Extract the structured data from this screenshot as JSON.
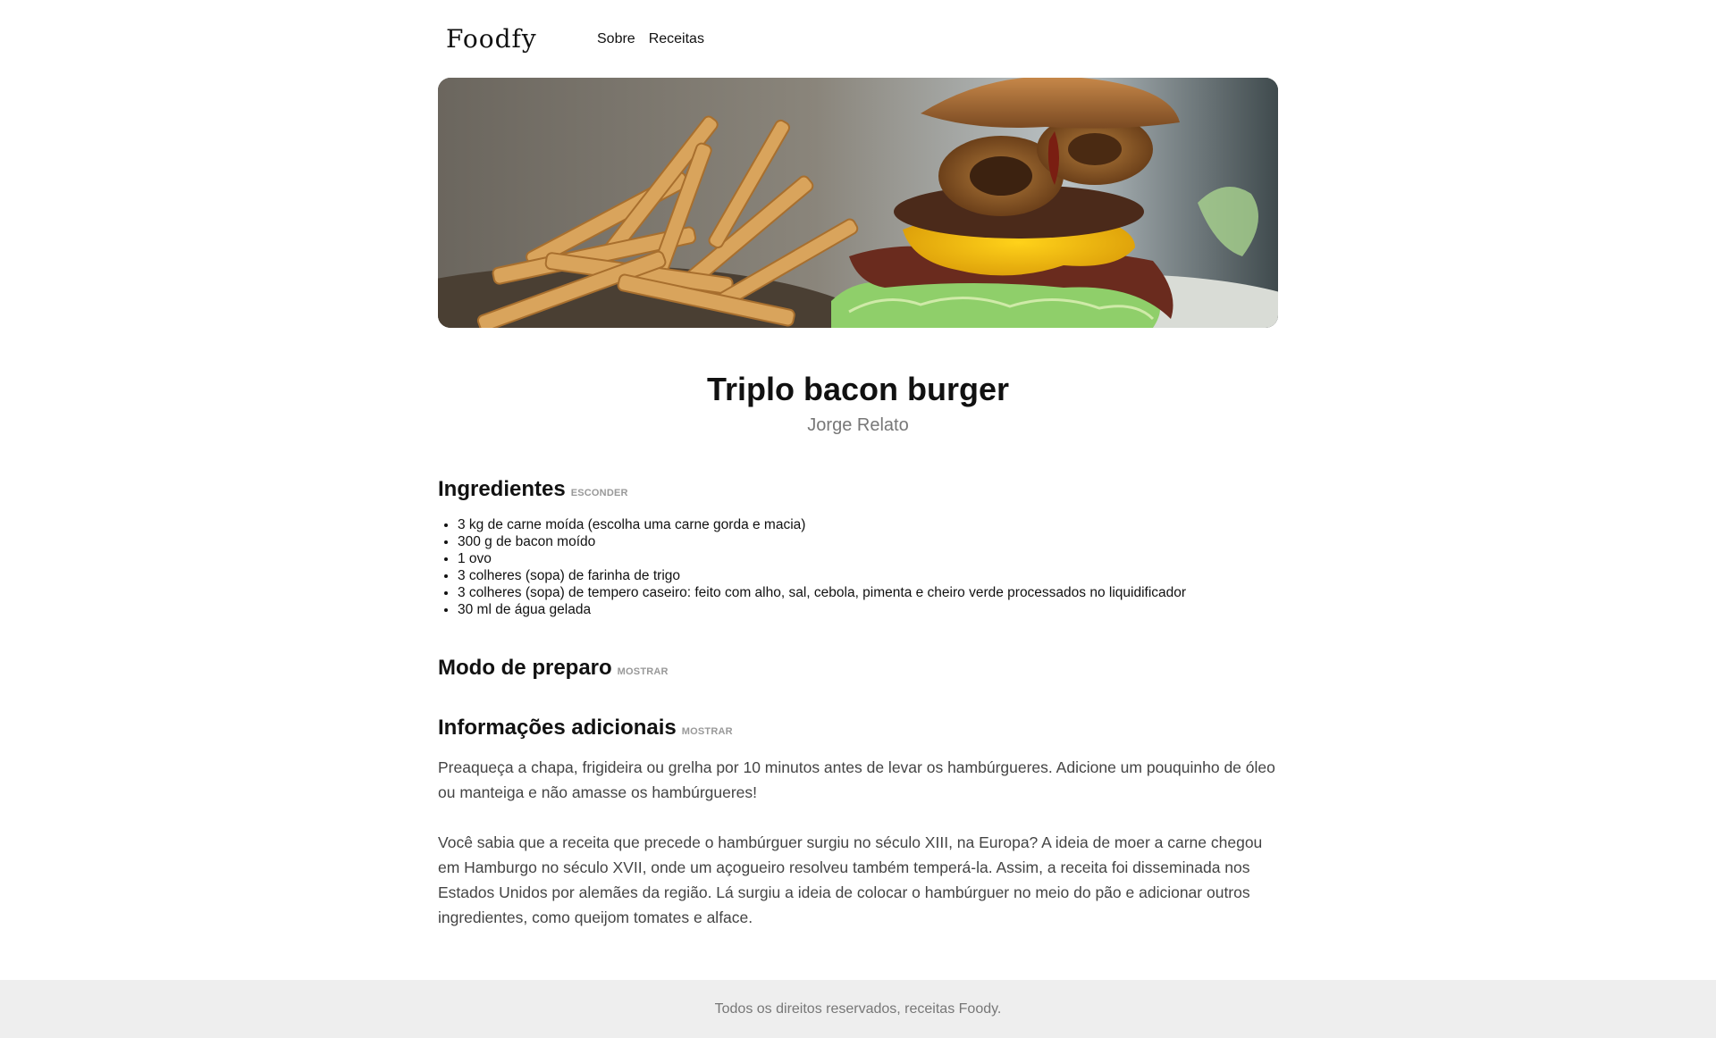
{
  "header": {
    "logo": "Foodfy",
    "nav": [
      {
        "label": "Sobre"
      },
      {
        "label": "Receitas"
      }
    ]
  },
  "hero": {
    "alt": "Triplo bacon burger with fries"
  },
  "recipe": {
    "title": "Triplo bacon burger",
    "author": "Jorge Relato"
  },
  "sections": {
    "ingredients": {
      "title": "Ingredientes",
      "toggle": "ESCONDER",
      "items": [
        "3 kg de carne moída (escolha uma carne gorda e macia)",
        "300 g de bacon moído",
        "1 ovo",
        "3 colheres (sopa) de farinha de trigo",
        "3 colheres (sopa) de tempero caseiro: feito com alho, sal, cebola, pimenta e cheiro verde processados no liquidificador",
        "30 ml de água gelada"
      ]
    },
    "preparation": {
      "title": "Modo de preparo",
      "toggle": "MOSTRAR"
    },
    "info": {
      "title": "Informações adicionais",
      "toggle": "MOSTRAR",
      "paragraphs": [
        "Preaqueça a chapa, frigideira ou grelha por 10 minutos antes de levar os hambúrgueres. Adicione um pouquinho de óleo ou manteiga e não amasse os hambúrgueres!",
        "Você sabia que a receita que precede o hambúrguer surgiu no século XIII, na Europa? A ideia de moer a carne chegou em Hamburgo no século XVII, onde um açogueiro resolveu também temperá-la. Assim, a receita foi disseminada nos Estados Unidos por alemães da região. Lá surgiu a ideia de colocar o hambúrguer no meio do pão e adicionar outros ingredientes, como queijom tomates e alface."
      ]
    }
  },
  "footer": {
    "text": "Todos os direitos reservados, receitas Foody."
  }
}
